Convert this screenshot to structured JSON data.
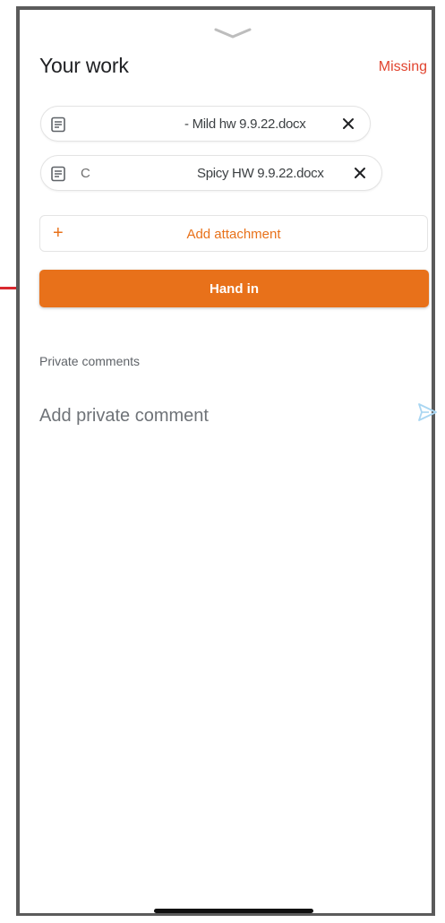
{
  "header": {
    "title": "Your work",
    "status": "Missing",
    "status_color": "#e1442f"
  },
  "attachments": [
    {
      "name": "- Mild hw 9.9.22.docx",
      "prefix_partial": "",
      "icon": "document-icon",
      "remove_icon": "close-icon"
    },
    {
      "name": "Spicy HW 9.9.22.docx",
      "prefix_partial": "C",
      "icon": "document-icon",
      "remove_icon": "close-icon"
    }
  ],
  "add_attachment": {
    "icon": "plus-icon",
    "label": "Add attachment"
  },
  "hand_in": {
    "label": "Hand in",
    "color": "#e8711a"
  },
  "comments": {
    "section_label": "Private comments",
    "placeholder": "Add private comment",
    "send_icon": "send-icon"
  },
  "accent_color": "#e8711a"
}
